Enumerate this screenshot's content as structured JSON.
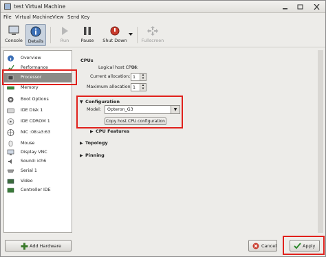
{
  "window": {
    "title": "test Virtual Machine"
  },
  "menu": {
    "items": [
      "File",
      "Virtual Machine",
      "View",
      "Send Key"
    ]
  },
  "toolbar": {
    "console": "Console",
    "details": "Details",
    "run": "Run",
    "pause": "Pause",
    "shutdown": "Shut Down",
    "fullscreen": "Fullscreen"
  },
  "sidebar": {
    "items": [
      {
        "label": "Overview",
        "icon": "info-icon"
      },
      {
        "label": "Performance",
        "icon": "graph-icon"
      },
      {
        "label": "Processor",
        "icon": "cpu-icon",
        "selected": true
      },
      {
        "label": "Memory",
        "icon": "memory-icon"
      },
      {
        "label": "Boot Options",
        "icon": "gear-icon"
      },
      {
        "label": "IDE Disk 1",
        "icon": "disk-icon"
      },
      {
        "label": "IDE CDROM 1",
        "icon": "cdrom-icon"
      },
      {
        "label": "NIC :08:a3:63",
        "icon": "nic-icon"
      },
      {
        "label": "Mouse",
        "icon": "mouse-icon"
      },
      {
        "label": "Display VNC",
        "icon": "display-icon"
      },
      {
        "label": "Sound: ich6",
        "icon": "sound-icon"
      },
      {
        "label": "Serial 1",
        "icon": "serial-icon"
      },
      {
        "label": "Video",
        "icon": "video-icon"
      },
      {
        "label": "Controller IDE",
        "icon": "controller-icon"
      }
    ],
    "add_hardware": "Add Hardware"
  },
  "cpus": {
    "title": "CPUs",
    "logical_label": "Logical host CPUs:",
    "logical_value": "16",
    "current_label": "Current allocation:",
    "current_value": "1",
    "maximum_label": "Maximum allocation:",
    "maximum_value": "1"
  },
  "configuration": {
    "title": "Configuration",
    "model_label": "Model:",
    "model_value": "Opteron_G3",
    "copy_button": "Copy host CPU configuration",
    "cpu_features": "CPU Features"
  },
  "topology": {
    "title": "Topology"
  },
  "pinning": {
    "title": "Pinning"
  },
  "footer": {
    "cancel": "Cancel",
    "apply": "Apply"
  },
  "colors": {
    "highlight": "#e0201b",
    "selected_row": "#8b8b87"
  }
}
